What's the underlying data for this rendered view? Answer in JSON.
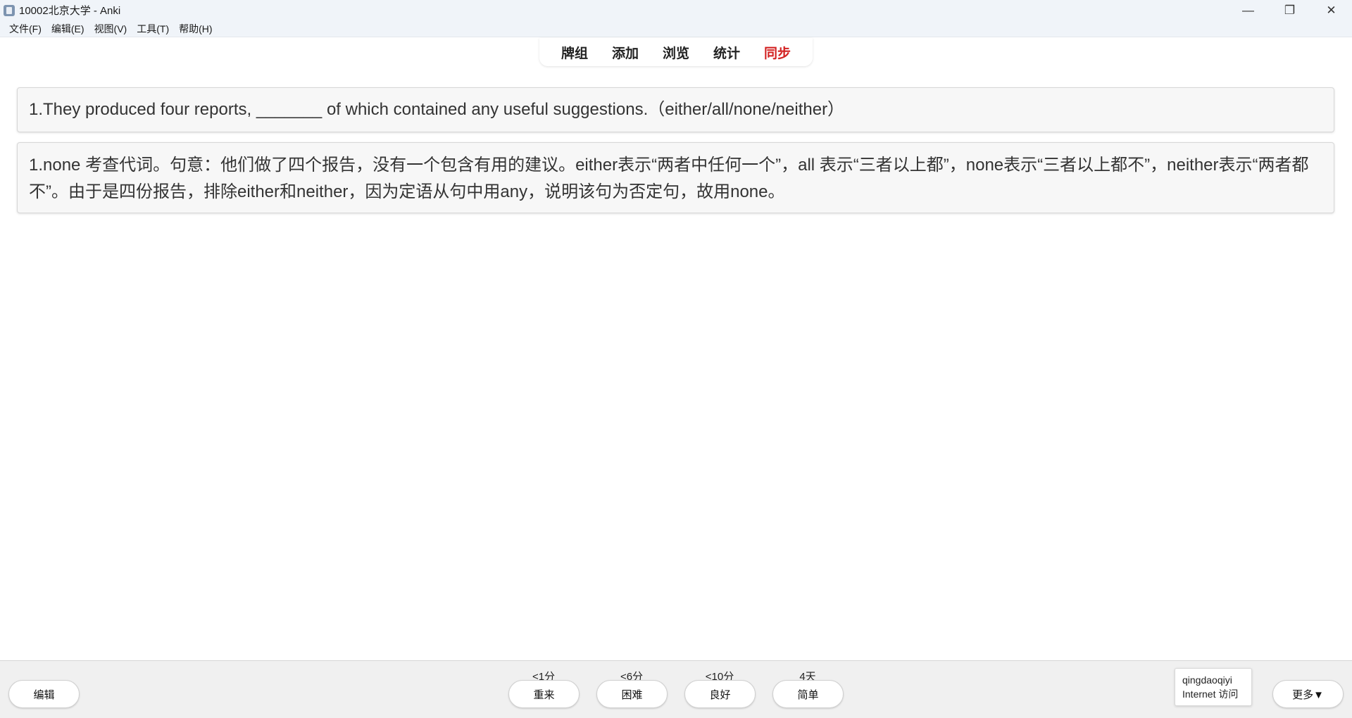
{
  "window": {
    "title": "10002北京大学 - Anki",
    "controls": {
      "minimize": "—",
      "restore": "❐",
      "close": "✕"
    }
  },
  "menu": [
    "文件(F)",
    "编辑(E)",
    "视图(V)",
    "工具(T)",
    "帮助(H)"
  ],
  "topnav": {
    "decks": "牌组",
    "add": "添加",
    "browse": "浏览",
    "stats": "统计",
    "sync": "同步",
    "sync_color": "#d32222"
  },
  "card": {
    "question": "1.They produced four reports, _______ of which contained any useful suggestions.（either/all/none/neither）",
    "answer": "1.none 考查代词。句意：他们做了四个报告，没有一个包含有用的建议。either表示“两者中任何一个”，all 表示“三者以上都”，none表示“三者以上都不”，neither表示“两者都不”。由于是四份报告，排除either和neither，因为定语从句中用any，说明该句为否定句，故用none。"
  },
  "bottom": {
    "edit_label": "编辑",
    "intervals": {
      "again": "<1分",
      "hard": "<6分",
      "good": "<10分",
      "easy": "4天"
    },
    "answers": {
      "again": "重来",
      "hard": "困难",
      "good": "良好",
      "easy": "简单"
    },
    "tooltip": {
      "line1": "qingdaoqiyi",
      "line2": "Internet 访问"
    },
    "more_label": "更多▼"
  }
}
